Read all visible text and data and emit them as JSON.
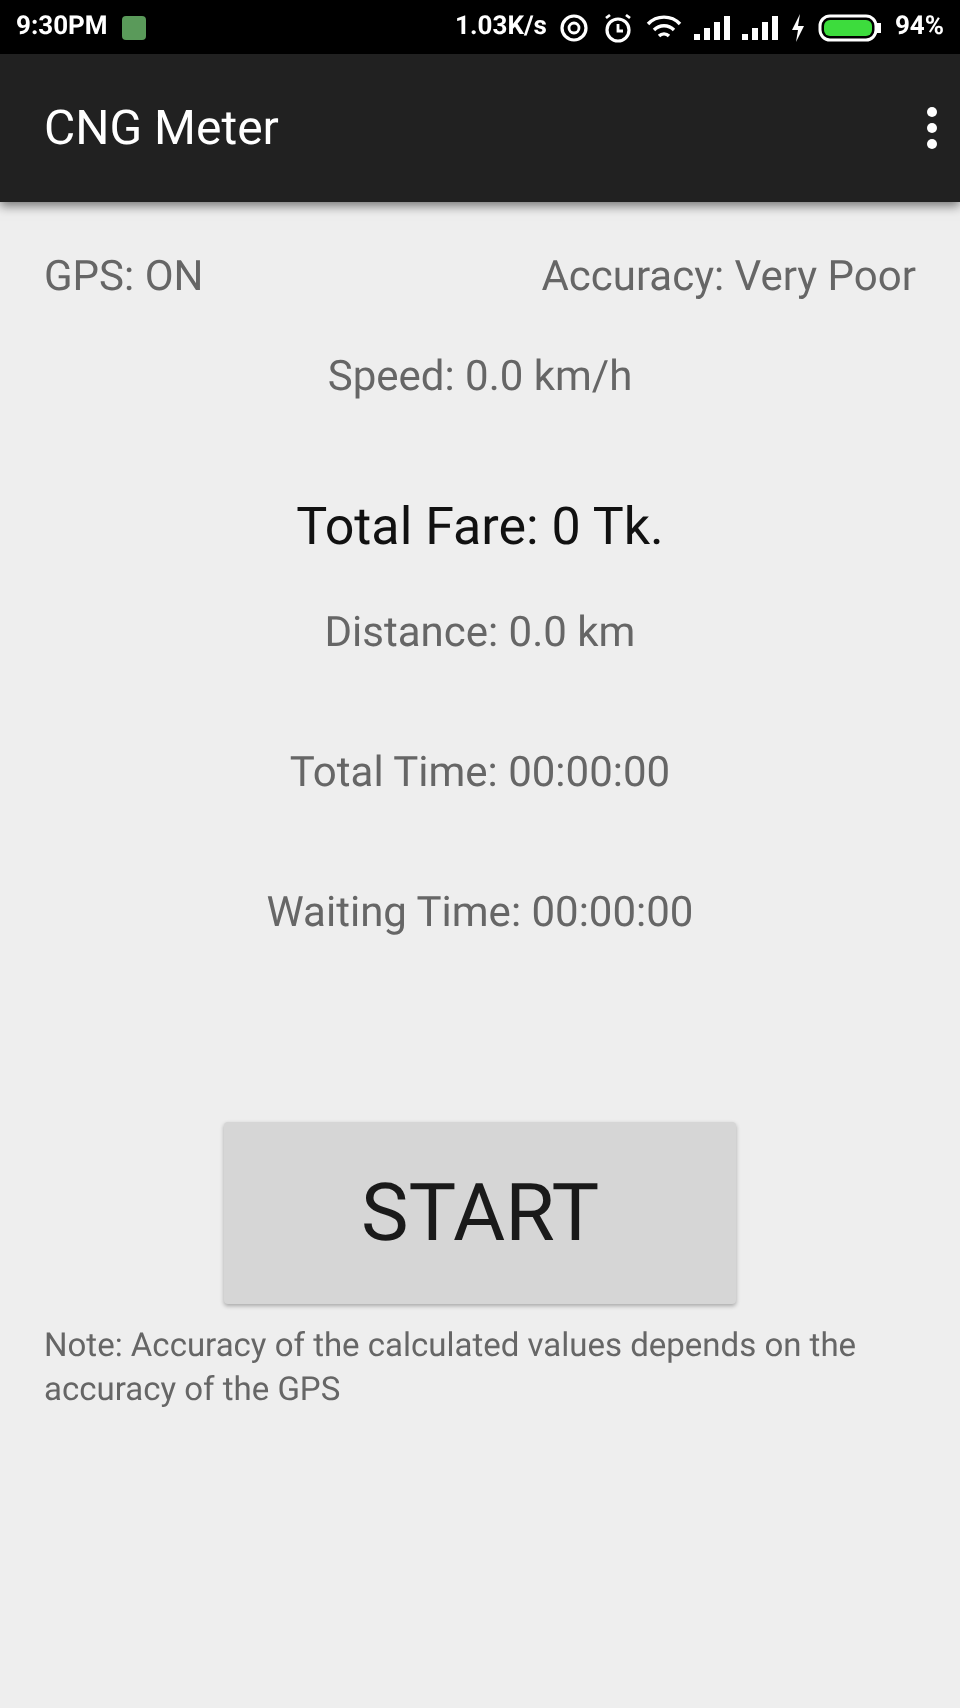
{
  "status_bar": {
    "time": "9:30PM",
    "speed": "1.03K/s",
    "battery": "94%"
  },
  "app_bar": {
    "title": "CNG Meter"
  },
  "gps": "GPS: ON",
  "accuracy": "Accuracy: Very Poor",
  "readings": [
    {
      "kind": "normal",
      "text": "Speed: 0.0 km/h"
    },
    {
      "kind": "main",
      "text": "Total Fare: 0 Tk."
    },
    {
      "kind": "normal",
      "text": "Distance: 0.0 km"
    },
    {
      "kind": "normal",
      "text": "Total Time: 00:00:00"
    },
    {
      "kind": "normal",
      "text": "Waiting Time: 00:00:00"
    }
  ],
  "start_button": "START",
  "note": "Note: Accuracy of the calculated values depends on the accuracy of the GPS"
}
